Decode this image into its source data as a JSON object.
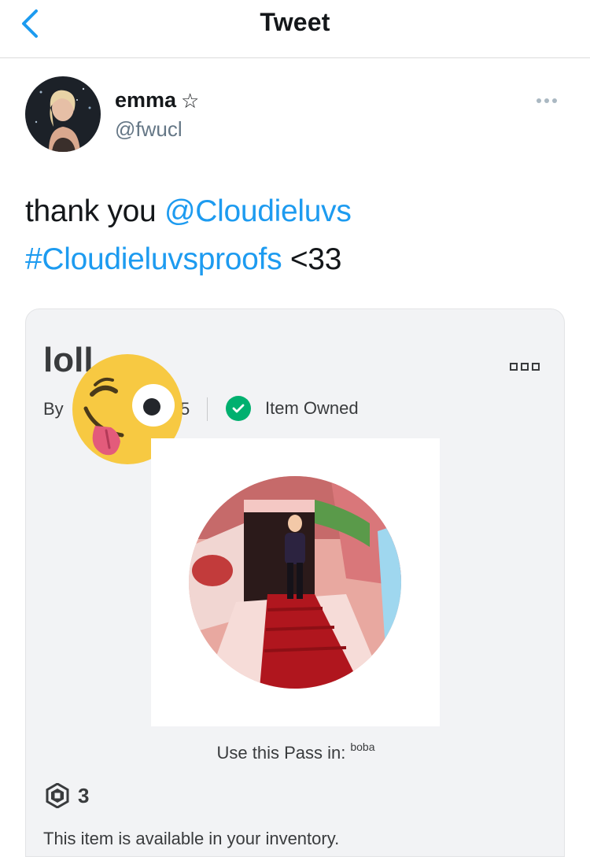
{
  "nav": {
    "title": "Tweet",
    "back_icon": "chevron-left-icon"
  },
  "tweet": {
    "display_name": "emma",
    "name_icon": "star-outline-icon",
    "star_glyph": "☆",
    "handle": "@fwucl",
    "text_prefix": "thank you ",
    "mention": "@Cloudieluvs",
    "hashtag": "#Cloudieluvsproofs",
    "text_suffix": " <33"
  },
  "card": {
    "item_title": "loll",
    "by_label": "By",
    "creator_fragment": "5",
    "owned_label": "Item Owned",
    "use_pass_label": "Use this Pass in:",
    "use_pass_game": "boba",
    "price": "3",
    "inventory_note": "This item is available in your inventory."
  },
  "colors": {
    "link": "#1d9bf0",
    "owned_check": "#00b06f",
    "muted": "#657786",
    "card_bg": "#f2f3f5"
  }
}
